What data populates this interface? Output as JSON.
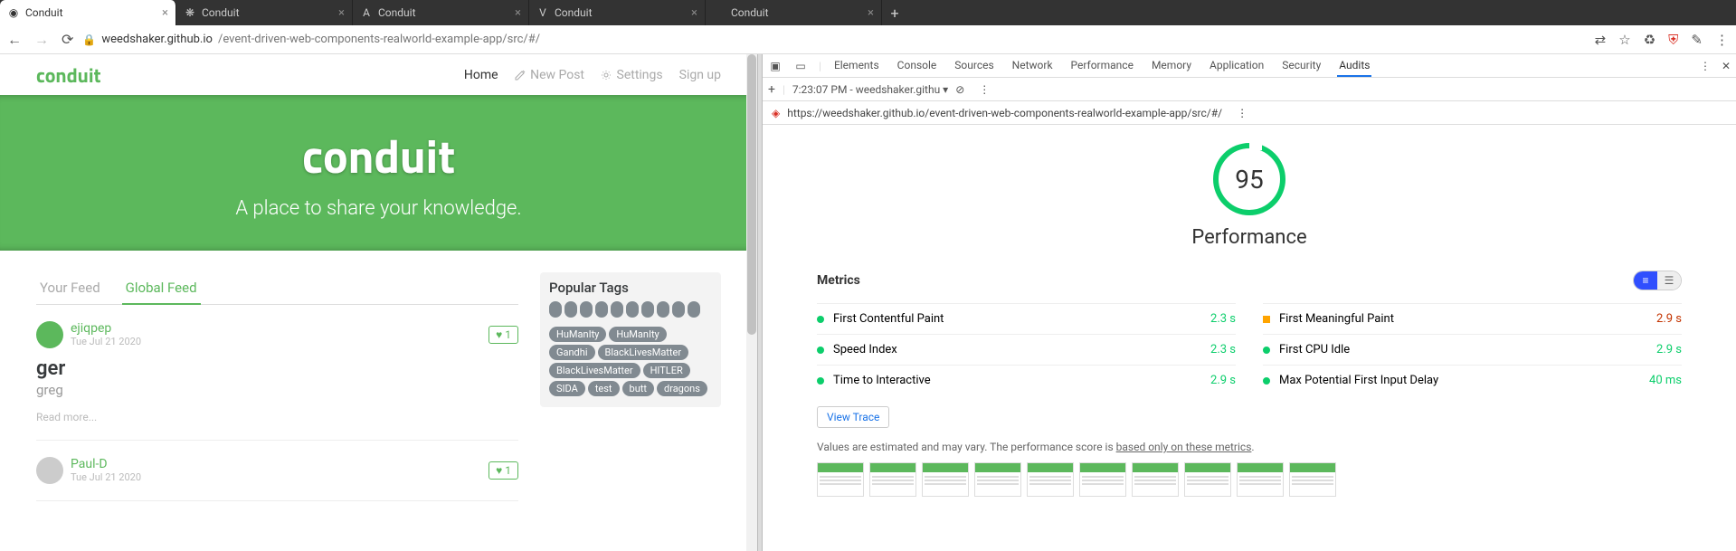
{
  "browser": {
    "tabs": [
      {
        "icon": "◉",
        "label": "Conduit",
        "active": true
      },
      {
        "icon": "❋",
        "label": "Conduit",
        "active": false
      },
      {
        "icon": "A",
        "label": "Conduit",
        "active": false
      },
      {
        "icon": "V",
        "label": "Conduit",
        "active": false
      },
      {
        "icon": "",
        "label": "Conduit",
        "active": false
      }
    ],
    "url_host": "weedshaker.github.io",
    "url_path": "/event-driven-web-components-realworld-example-app/src/#/"
  },
  "page": {
    "brand": "conduit",
    "nav": {
      "home": "Home",
      "newpost": "New Post",
      "settings": "Settings",
      "signup": "Sign up"
    },
    "banner": {
      "title": "conduit",
      "subtitle": "A place to share your knowledge."
    },
    "feed_tabs": {
      "your": "Your Feed",
      "global": "Global Feed"
    },
    "articles": [
      {
        "author": "ejiqpep",
        "date": "Tue Jul 21 2020",
        "title": "ger",
        "desc": "greg",
        "likes": "1",
        "readmore": "Read more...",
        "avatar": "green"
      },
      {
        "author": "Paul-D",
        "date": "Tue Jul 21 2020",
        "title": "",
        "desc": "",
        "likes": "1",
        "readmore": "",
        "avatar": "grey"
      }
    ],
    "tags_title": "Popular Tags",
    "tags_blobs": 10,
    "tags": [
      "HuManIty",
      "HuManIty",
      "Gandhi",
      "BlackLivesMatter",
      "BlackLivesMatter",
      "HITLER",
      "SIDA",
      "test",
      "butt",
      "dragons"
    ]
  },
  "devtools": {
    "panels": [
      "Elements",
      "Console",
      "Sources",
      "Network",
      "Performance",
      "Memory",
      "Application",
      "Security",
      "Audits"
    ],
    "active_panel": "Audits",
    "dropdown": "7:23:07 PM - weedshaker.githu",
    "audit_url": "https://weedshaker.github.io/event-driven-web-components-realworld-example-app/src/#/",
    "score": "95",
    "score_label": "Performance",
    "metrics_label": "Metrics",
    "metrics": [
      {
        "name": "First Contentful Paint",
        "value": "2.3 s",
        "status": "green",
        "col": 0
      },
      {
        "name": "First Meaningful Paint",
        "value": "2.9 s",
        "status": "orange",
        "col": 1
      },
      {
        "name": "Speed Index",
        "value": "2.3 s",
        "status": "green",
        "col": 0
      },
      {
        "name": "First CPU Idle",
        "value": "2.9 s",
        "status": "green",
        "col": 1
      },
      {
        "name": "Time to Interactive",
        "value": "2.9 s",
        "status": "green",
        "col": 0
      },
      {
        "name": "Max Potential First Input Delay",
        "value": "40 ms",
        "status": "green",
        "col": 1
      }
    ],
    "view_trace": "View Trace",
    "disclaimer_pre": "Values are estimated and may vary. The performance score is ",
    "disclaimer_link": "based only on these metrics",
    "frames": 10
  }
}
